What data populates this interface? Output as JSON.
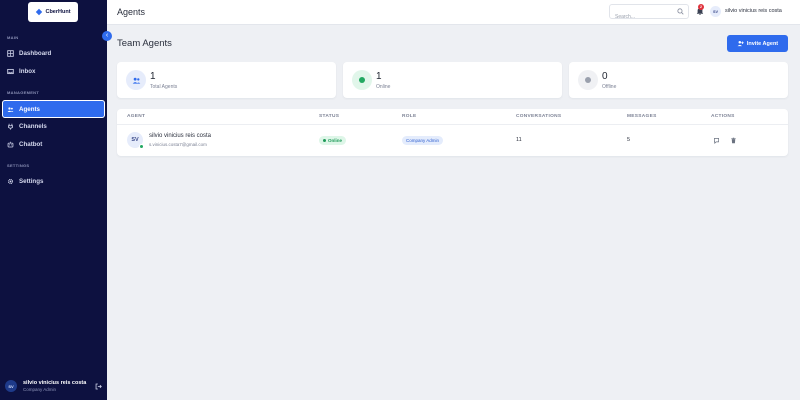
{
  "app": {
    "logo_text": "CberHunt"
  },
  "sidebar": {
    "sections": {
      "main": "MAIN",
      "management": "MANAGEMENT",
      "settings": "SETTINGS"
    },
    "items": [
      {
        "label": "Dashboard",
        "icon": "dashboard-icon"
      },
      {
        "label": "Inbox",
        "icon": "inbox-icon"
      },
      {
        "label": "Agents",
        "icon": "users-icon",
        "active": true
      },
      {
        "label": "Channels",
        "icon": "channels-icon"
      },
      {
        "label": "Chatbot",
        "icon": "chatbot-icon"
      },
      {
        "label": "Settings",
        "icon": "gear-icon"
      }
    ],
    "user": {
      "initials": "SV",
      "name": "silvio vinicius reis costa",
      "role": "Company Admin"
    }
  },
  "topbar": {
    "title": "Agents",
    "search_placeholder": "Search...",
    "notification_count": "2",
    "user_initials": "SV",
    "user_name": "silvio vinicius reis costa"
  },
  "main": {
    "title": "Team Agents",
    "invite_label": "Invite Agent",
    "stats": [
      {
        "value": "1",
        "label": "Total Agents"
      },
      {
        "value": "1",
        "label": "Online"
      },
      {
        "value": "0",
        "label": "Offline"
      }
    ],
    "table": {
      "columns": [
        "AGENT",
        "STATUS",
        "ROLE",
        "CONVERSATIONS",
        "MESSAGES",
        "ACTIONS"
      ],
      "rows": [
        {
          "initials": "SV",
          "name": "silvio vinicius reis costa",
          "email": "s.vinicius.costa7@gmail.com",
          "status": "Online",
          "role": "Company Admin",
          "conversations": "11",
          "messages": "5"
        }
      ]
    }
  },
  "colors": {
    "sidebar_bg": "#0d1140",
    "accent": "#2f6bed",
    "online": "#22a861",
    "background": "#eef0f4"
  }
}
